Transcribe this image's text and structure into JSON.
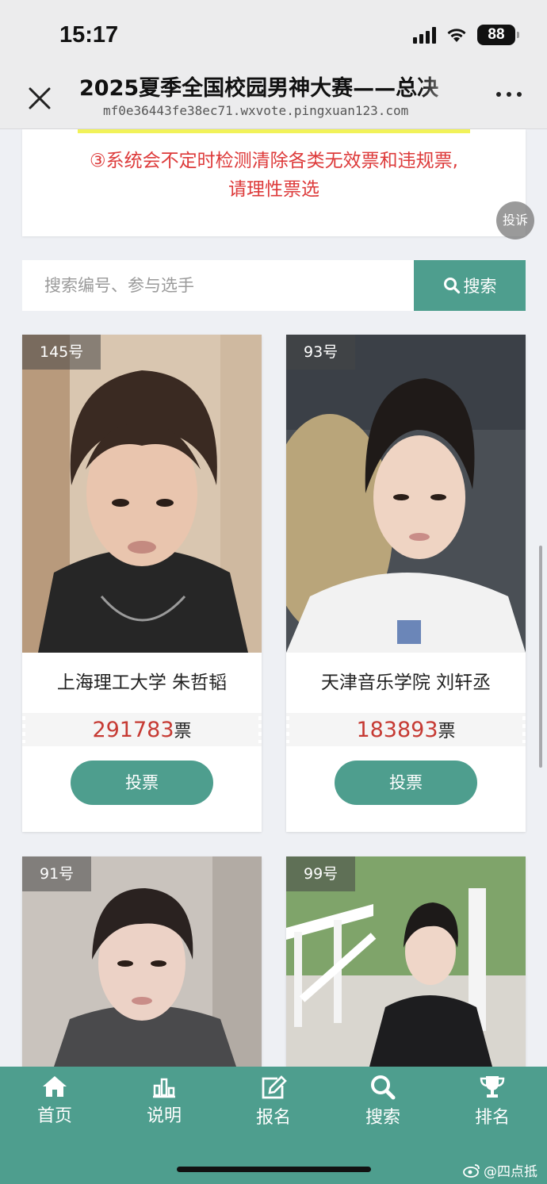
{
  "status_bar": {
    "time": "15:17",
    "battery": "88"
  },
  "header": {
    "title": "2025夏季全国校园男神大赛——总决",
    "url": "mf0e36443fe38ec71.wxvote.pingxuan123.com"
  },
  "notice": {
    "line1": "③系统会不定时检测清除各类无效票和违规票,",
    "line2": "请理性票选"
  },
  "report_button": "投诉",
  "search": {
    "placeholder": "搜索编号、参与选手",
    "button_label": "搜索"
  },
  "contestants": [
    {
      "number": "145号",
      "name": "上海理工大学 朱哲韬",
      "votes": "291783",
      "vote_unit": "票",
      "vote_button": "投票"
    },
    {
      "number": "93号",
      "name": "天津音乐学院 刘轩丞",
      "votes": "183893",
      "vote_unit": "票",
      "vote_button": "投票"
    },
    {
      "number": "91号"
    },
    {
      "number": "99号"
    }
  ],
  "tab_bar": [
    {
      "label": "首页",
      "icon": "home-icon"
    },
    {
      "label": "说明",
      "icon": "chart-icon"
    },
    {
      "label": "报名",
      "icon": "edit-icon"
    },
    {
      "label": "搜索",
      "icon": "search-icon"
    },
    {
      "label": "排名",
      "icon": "trophy-icon"
    }
  ],
  "watermark": "@四点抵",
  "colors": {
    "accent": "#4e9e8e",
    "vote_count": "#c63a33",
    "notice_red": "#dd3a3a"
  }
}
